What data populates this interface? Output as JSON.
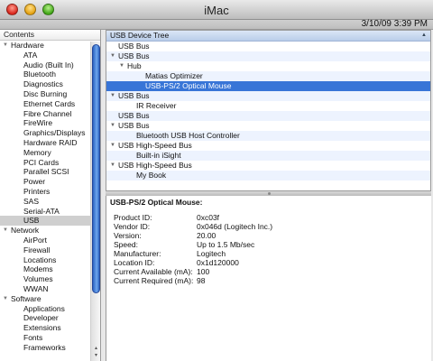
{
  "window": {
    "title": "iMac"
  },
  "toolbar": {
    "date": "3/10/09 3:39 PM"
  },
  "sidebar": {
    "header": "Contents",
    "items": [
      {
        "label": "Hardware",
        "type": "group"
      },
      {
        "label": "ATA",
        "type": "child"
      },
      {
        "label": "Audio (Built In)",
        "type": "child"
      },
      {
        "label": "Bluetooth",
        "type": "child"
      },
      {
        "label": "Diagnostics",
        "type": "child"
      },
      {
        "label": "Disc Burning",
        "type": "child"
      },
      {
        "label": "Ethernet Cards",
        "type": "child"
      },
      {
        "label": "Fibre Channel",
        "type": "child"
      },
      {
        "label": "FireWire",
        "type": "child"
      },
      {
        "label": "Graphics/Displays",
        "type": "child"
      },
      {
        "label": "Hardware RAID",
        "type": "child"
      },
      {
        "label": "Memory",
        "type": "child"
      },
      {
        "label": "PCI Cards",
        "type": "child"
      },
      {
        "label": "Parallel SCSI",
        "type": "child"
      },
      {
        "label": "Power",
        "type": "child"
      },
      {
        "label": "Printers",
        "type": "child"
      },
      {
        "label": "SAS",
        "type": "child"
      },
      {
        "label": "Serial-ATA",
        "type": "child"
      },
      {
        "label": "USB",
        "type": "child",
        "selected": true
      },
      {
        "label": "Network",
        "type": "group"
      },
      {
        "label": "AirPort",
        "type": "child"
      },
      {
        "label": "Firewall",
        "type": "child"
      },
      {
        "label": "Locations",
        "type": "child"
      },
      {
        "label": "Modems",
        "type": "child"
      },
      {
        "label": "Volumes",
        "type": "child"
      },
      {
        "label": "WWAN",
        "type": "child"
      },
      {
        "label": "Software",
        "type": "group"
      },
      {
        "label": "Applications",
        "type": "child"
      },
      {
        "label": "Developer",
        "type": "child"
      },
      {
        "label": "Extensions",
        "type": "child"
      },
      {
        "label": "Fonts",
        "type": "child"
      },
      {
        "label": "Frameworks",
        "type": "child"
      }
    ]
  },
  "tree": {
    "header": "USB Device Tree",
    "rows": [
      {
        "label": "USB Bus",
        "level": 0,
        "expandable": false
      },
      {
        "label": "USB Bus",
        "level": 0,
        "expandable": true
      },
      {
        "label": "Hub",
        "level": 1,
        "expandable": true
      },
      {
        "label": "Matias Optimizer",
        "level": 3,
        "expandable": false
      },
      {
        "label": "USB-PS/2 Optical Mouse",
        "level": 3,
        "expandable": false,
        "selected": true
      },
      {
        "label": "USB Bus",
        "level": 0,
        "expandable": true
      },
      {
        "label": "IR Receiver",
        "level": 2,
        "expandable": false
      },
      {
        "label": "USB Bus",
        "level": 0,
        "expandable": false
      },
      {
        "label": "USB Bus",
        "level": 0,
        "expandable": true
      },
      {
        "label": "Bluetooth USB Host Controller",
        "level": 2,
        "expandable": false
      },
      {
        "label": "USB High-Speed Bus",
        "level": 0,
        "expandable": true
      },
      {
        "label": "Built-in iSight",
        "level": 2,
        "expandable": false
      },
      {
        "label": "USB High-Speed Bus",
        "level": 0,
        "expandable": true
      },
      {
        "label": "My Book",
        "level": 2,
        "expandable": false
      }
    ]
  },
  "detail": {
    "title": "USB-PS/2 Optical Mouse:",
    "properties": [
      {
        "key": "Product ID:",
        "value": "0xc03f"
      },
      {
        "key": "Vendor ID:",
        "value": "0x046d  (Logitech Inc.)"
      },
      {
        "key": "Version:",
        "value": "20.00"
      },
      {
        "key": "Speed:",
        "value": "Up to 1.5 Mb/sec"
      },
      {
        "key": "Manufacturer:",
        "value": "Logitech"
      },
      {
        "key": "Location ID:",
        "value": "0x1d120000"
      },
      {
        "key": "Current Available (mA):",
        "value": "100"
      },
      {
        "key": "Current Required (mA):",
        "value": "98"
      }
    ]
  },
  "colors": {
    "selection": "#3875d7",
    "tree_alt_row": "#edf3fe",
    "sidebar_selected": "#cfcfcf"
  },
  "icons": [
    "close-button",
    "minimize-button",
    "zoom-button",
    "disclosure-triangle-icon",
    "sort-indicator-icon"
  ]
}
